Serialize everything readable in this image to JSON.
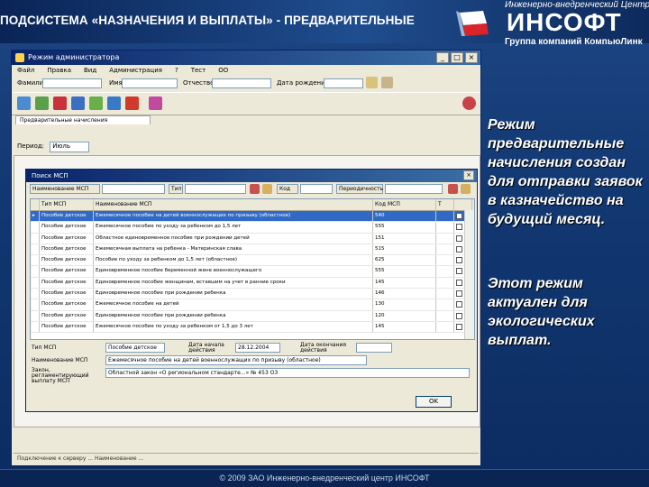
{
  "slide": {
    "title": "ПОДСИСТЕМА «НАЗНАЧЕНИЯ И ВЫПЛАТЫ» - ПРЕДВАРИТЕЛЬНЫЕ",
    "logo_top": "Инженерно-внедренческий Центр",
    "logo_main": "ИНСОФТ",
    "logo_bottom": "Группа компаний КомпьюЛинк",
    "caption1": "Режим предварительные начисления создан для отправки заявок в казначейство на будущий месяц.",
    "caption2": "Этот режим актуален для экологических выплат.",
    "copyright": "© 2009 ЗАО Инженерно-внедренческий центр ИНСОФТ"
  },
  "app": {
    "window_title": "Режим администратора",
    "window_buttons": [
      "_",
      "□",
      "×"
    ],
    "menu": [
      "Файл",
      "Правка",
      "Вид",
      "Администрация",
      "?",
      "Тест",
      "ОО"
    ],
    "search_labels": {
      "lastname": "Фамилия",
      "firstname": "Имя",
      "patronymic": "Отчество",
      "birthdate": "Дата рождения"
    },
    "tab_label": "Предварительные начисления",
    "period_label": "Период:",
    "period_value": "Июль",
    "status_text": "Подключение к серверу ... Наименование ..."
  },
  "dialog": {
    "title": "Поиск МСП",
    "filter": {
      "name_label": "Наименование МСП",
      "type_label": "Тип",
      "code_label": "Код",
      "periodicity_label": "Периодичность"
    },
    "columns": [
      "Тип МСП",
      "Наименование МСП",
      "Код МСП",
      "Т"
    ],
    "rows": [
      {
        "type": "Пособие детское",
        "name": "Ежемесячное пособие на детей военнослужащих по призыву (областное)",
        "code": "540",
        "selected": true
      },
      {
        "type": "Пособие детское",
        "name": "Ежемесячное пособие по уходу за ребенком до 1,5 лет",
        "code": "555",
        "selected": false
      },
      {
        "type": "Пособие детское",
        "name": "Областное единовременное пособие при рождении детей",
        "code": "151",
        "selected": false
      },
      {
        "type": "Пособие детское",
        "name": "Ежемесячная выплата на ребенка - Материнская слава",
        "code": "515",
        "selected": false
      },
      {
        "type": "Пособие детское",
        "name": "Пособие по уходу за ребенком до 1,5 лет (областное)",
        "code": "625",
        "selected": false
      },
      {
        "type": "Пособие детское",
        "name": "Единовременное пособие беременной жене военнослужащего",
        "code": "555",
        "selected": false
      },
      {
        "type": "Пособие детское",
        "name": "Единовременное пособие женщинам, вставшим на учет в ранние сроки",
        "code": "145",
        "selected": false
      },
      {
        "type": "Пособие детское",
        "name": "Единовременное пособие при рождении ребенка",
        "code": "146",
        "selected": false
      },
      {
        "type": "Пособие детское",
        "name": "Ежемесячное пособие на детей",
        "code": "130",
        "selected": false
      },
      {
        "type": "Пособие детское",
        "name": "Единовременное пособие при рождении ребенка",
        "code": "120",
        "selected": false
      },
      {
        "type": "Пособие детское",
        "name": "Ежемесячное пособие по уходу за ребенком от 1,5 до 3 лет",
        "code": "145",
        "selected": false
      }
    ],
    "detail": {
      "type_label": "Тип МСП",
      "type_value": "Пособие детское",
      "start_label": "Дата начала действия",
      "start_value": "28.12.2004",
      "end_label": "Дата окончания действия",
      "name_label": "Наименование МСП",
      "name_value": "Ежемесячное пособие на детей военнослужащих по призыву (областное)",
      "law_label": "Закон, регламентирующий выплату МСП",
      "law_value": "Областной закон «О региональном стандарте...» № 453 ОЗ"
    },
    "ok_label": "OK"
  },
  "colors": {
    "window_title": "#0a246a",
    "selected_row": "#316ac5",
    "slide_bg": "#123872"
  }
}
